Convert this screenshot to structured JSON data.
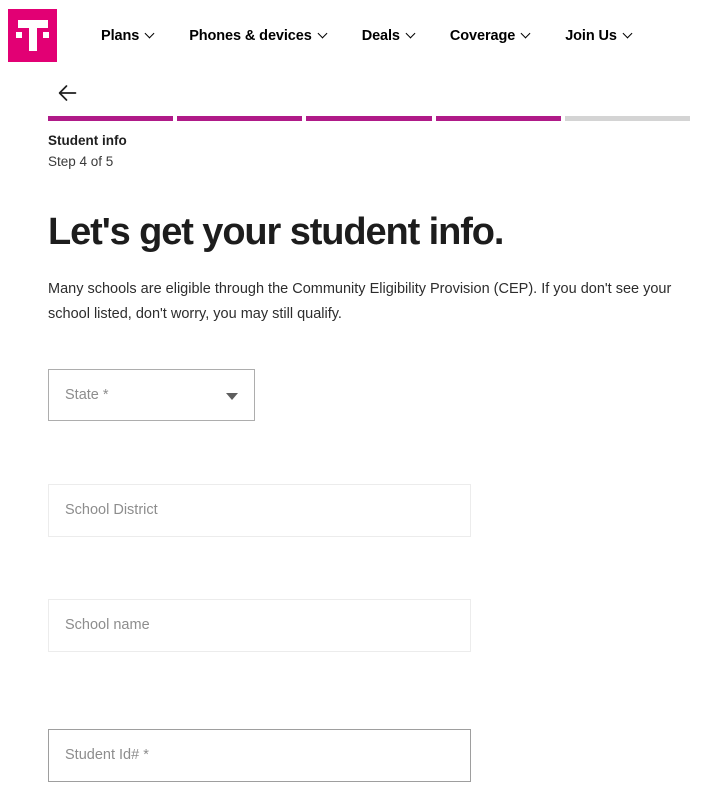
{
  "brand": {
    "logo_name": "T-Mobile",
    "magenta": "#e20074"
  },
  "nav": {
    "items": [
      {
        "label": "Plans",
        "icon": "chevron-down-icon"
      },
      {
        "label": "Phones & devices",
        "icon": "chevron-down-icon"
      },
      {
        "label": "Deals",
        "icon": "chevron-down-icon"
      },
      {
        "label": "Coverage",
        "icon": "chevron-down-icon"
      },
      {
        "label": "Join Us",
        "icon": "chevron-down-icon"
      }
    ]
  },
  "back": {
    "icon": "back-arrow-icon"
  },
  "progress": {
    "total_steps": 5,
    "completed_steps": 4,
    "filled_color": "#b01a88",
    "empty_color": "#d4d4d4",
    "segments": [
      "done",
      "done",
      "done",
      "done",
      "todo"
    ]
  },
  "step": {
    "title": "Student info",
    "subtitle": "Step 4 of 5"
  },
  "main": {
    "heading": "Let's get your student info.",
    "description": "Many schools are eligible through the Community Eligibility Provision (CEP). If you don't see your school listed, don't worry, you may still qualify."
  },
  "form": {
    "state": {
      "placeholder": "State *",
      "value": "",
      "icon": "chevron-down-icon"
    },
    "school_district": {
      "placeholder": "School District",
      "value": ""
    },
    "school_name": {
      "placeholder": "School name",
      "value": ""
    },
    "student_id": {
      "placeholder": "Student Id# *",
      "value": ""
    }
  }
}
